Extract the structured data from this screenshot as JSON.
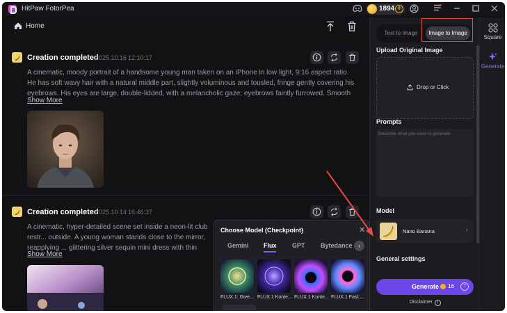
{
  "app": {
    "title": "HitPaw FotorPea",
    "coins": "1894"
  },
  "toolbar": {
    "home_label": "Home"
  },
  "feed": {
    "cards": [
      {
        "title": "Creation completed",
        "date": "2025.10.16",
        "time": "12:10:17",
        "prompt": "A cinematic, moody portrait of a handsome young man taken on an iPhone in low light, 9:16 aspect ratio. He has soft wavy hair with a natural middle part, slightly voluminous and tousled, fringe gently covering his eyebrows. His eyes are large, double-lidded, with a melancholic gaze; eyebrows faintly furrowed. Smooth oval face with sh...",
        "show_more": "Show More"
      },
      {
        "title": "Creation completed",
        "date": "2025.10.14",
        "time": "16:46:37",
        "prompt": "A cinematic, hyper-detailed scene set inside a neon-lit club restr... outside. A young woman stands close to the mirror, reapplying ... glittering silver sequin mini dress with thin straps, matching hoo...",
        "show_more": "Show More"
      }
    ]
  },
  "panel": {
    "tabs": [
      "Text to Image",
      "Image to Image"
    ],
    "active_tab": "Image to Image",
    "upload_label": "Upload Original Image",
    "upload_button": "Drop or Click",
    "prompts_label": "Prompts",
    "prompts_placeholder": "Describe what you want to generate",
    "model_label": "Model",
    "model_name": "Nano Banana",
    "general_settings_label": "General settings",
    "generate_label": "Generate",
    "generate_cost": "16",
    "disclaimer": "Disclaimer"
  },
  "rail": {
    "square_label": "Square",
    "generate_label": "Generate"
  },
  "model_popup": {
    "title": "Choose Model (Checkpoint)",
    "tabs": [
      "Gemini",
      "Flux",
      "GPT",
      "Bytedance"
    ],
    "active_tab": "Flux",
    "models": [
      "FLUX.1: Give...",
      "FLUX.1 Konte...",
      "FLUX.1 Konte...",
      "FLUX.1 Fast:..."
    ]
  },
  "colors": {
    "accent": "#6b46e8",
    "highlight": "#e84a4a",
    "background": "#121214"
  }
}
